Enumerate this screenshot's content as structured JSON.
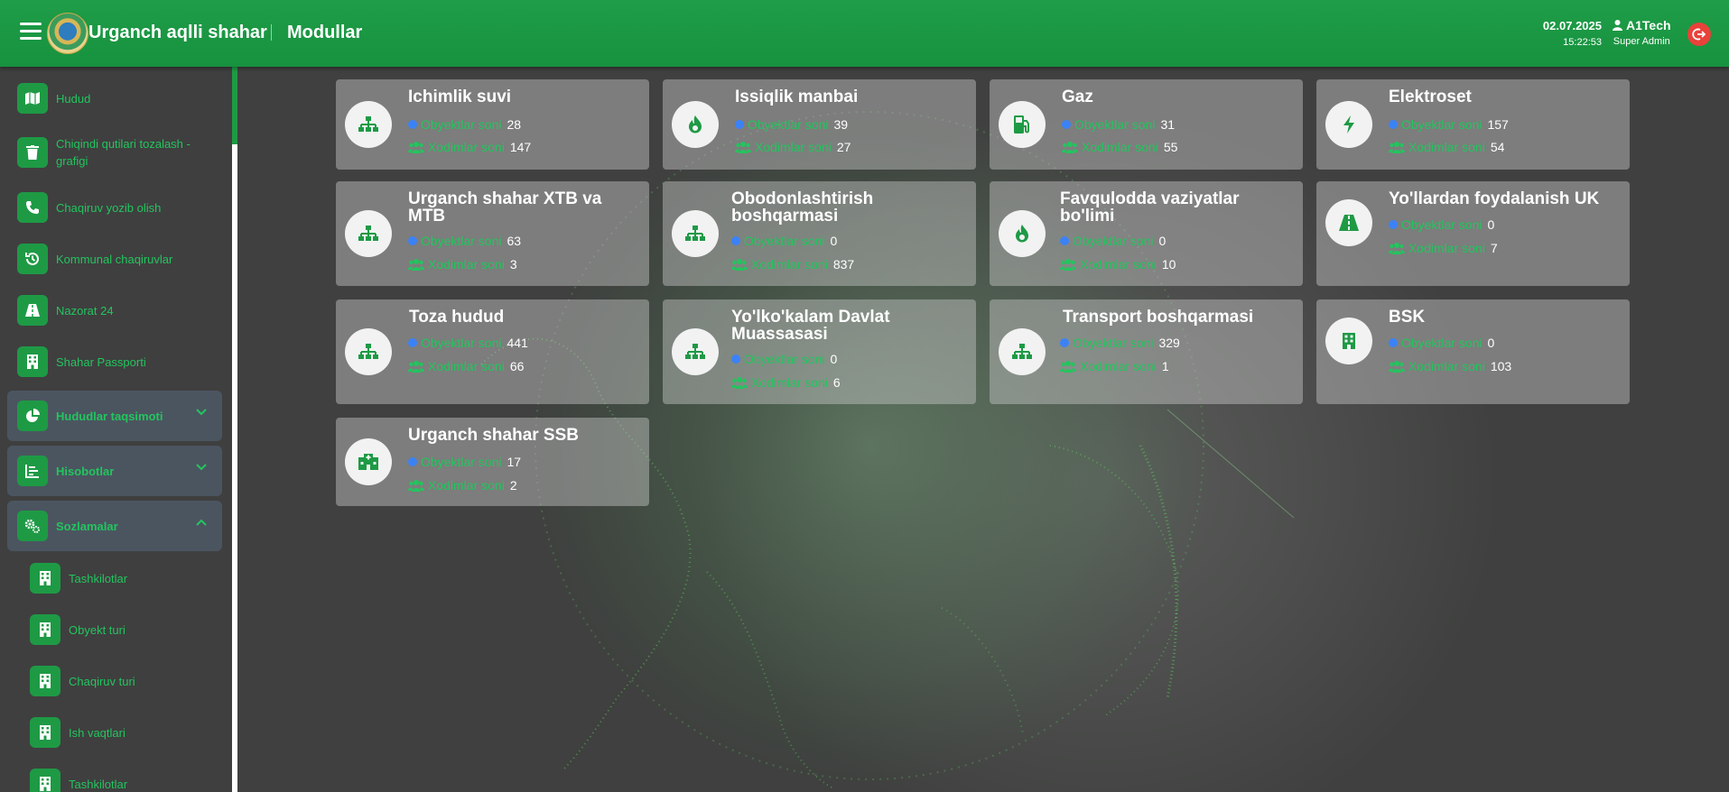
{
  "header": {
    "brand": "Urganch aqlli shahar",
    "module": "Modullar",
    "date": "02.07.2025",
    "time": "15:22:53",
    "user_name": "A1Tech",
    "user_role": "Super Admin"
  },
  "sidebar": {
    "items": [
      {
        "label": "Hudud",
        "icon": "map-icon"
      },
      {
        "label": "Chiqindi qutilari tozalash - grafigi",
        "icon": "trash-icon"
      },
      {
        "label": "Chaqiruv yozib olish",
        "icon": "phone-icon"
      },
      {
        "label": "Kommunal chaqiruvlar",
        "icon": "history-icon"
      },
      {
        "label": "Nazorat 24",
        "icon": "road-icon"
      },
      {
        "label": "Shahar Passporti",
        "icon": "building-icon"
      }
    ],
    "groups": [
      {
        "label": "Hududlar taqsimoti",
        "icon": "pie-chart-icon",
        "expanded": false
      },
      {
        "label": "Hisobotlar",
        "icon": "bar-chart-icon",
        "expanded": false
      },
      {
        "label": "Sozlamalar",
        "icon": "gears-icon",
        "expanded": true
      }
    ],
    "subitems": [
      {
        "label": "Tashkilotlar",
        "icon": "building-icon"
      },
      {
        "label": "Obyekt turi",
        "icon": "building-icon"
      },
      {
        "label": "Chaqiruv turi",
        "icon": "building-icon"
      },
      {
        "label": "Ish vaqtlari",
        "icon": "building-icon"
      },
      {
        "label": "Tashkilotlar",
        "icon": "building-icon"
      }
    ]
  },
  "labels": {
    "objects": "Obyektlar soni",
    "staff": "Xodimlar soni"
  },
  "cards": [
    {
      "title": "Ichimlik suvi",
      "objects": "28",
      "staff": "147",
      "icon": "sitemap-icon"
    },
    {
      "title": "Issiqlik manbai",
      "objects": "39",
      "staff": "27",
      "icon": "fire-icon"
    },
    {
      "title": "Gaz",
      "objects": "31",
      "staff": "55",
      "icon": "gas-pump-icon"
    },
    {
      "title": "Elektroset",
      "objects": "157",
      "staff": "54",
      "icon": "bolt-icon"
    },
    {
      "title": "Urganch shahar XTB va MTB",
      "objects": "63",
      "staff": "3",
      "icon": "sitemap-icon"
    },
    {
      "title": "Obodonlashtirish boshqarmasi",
      "objects": "0",
      "staff": "837",
      "icon": "sitemap-icon"
    },
    {
      "title": "Favqulodda vaziyatlar bo'limi",
      "objects": "0",
      "staff": "10",
      "icon": "fire-icon"
    },
    {
      "title": "Yo'llardan foydalanish UK",
      "objects": "0",
      "staff": "7",
      "icon": "road-icon"
    },
    {
      "title": "Toza hudud",
      "objects": "441",
      "staff": "66",
      "icon": "sitemap-icon"
    },
    {
      "title": "Yo'lko'kalam Davlat Muassasasi",
      "objects": "0",
      "staff": "6",
      "icon": "sitemap-icon"
    },
    {
      "title": "Transport boshqarmasi",
      "objects": "329",
      "staff": "1",
      "icon": "sitemap-icon"
    },
    {
      "title": "BSK",
      "objects": "0",
      "staff": "103",
      "icon": "building-icon"
    },
    {
      "title": "Urganch shahar SSB",
      "objects": "17",
      "staff": "2",
      "icon": "hospital-icon"
    }
  ],
  "colors": {
    "accent": "#1e9a45",
    "label_green": "#22c55e",
    "dot_blue": "#3b82f6",
    "logout_red": "#e8423a"
  }
}
